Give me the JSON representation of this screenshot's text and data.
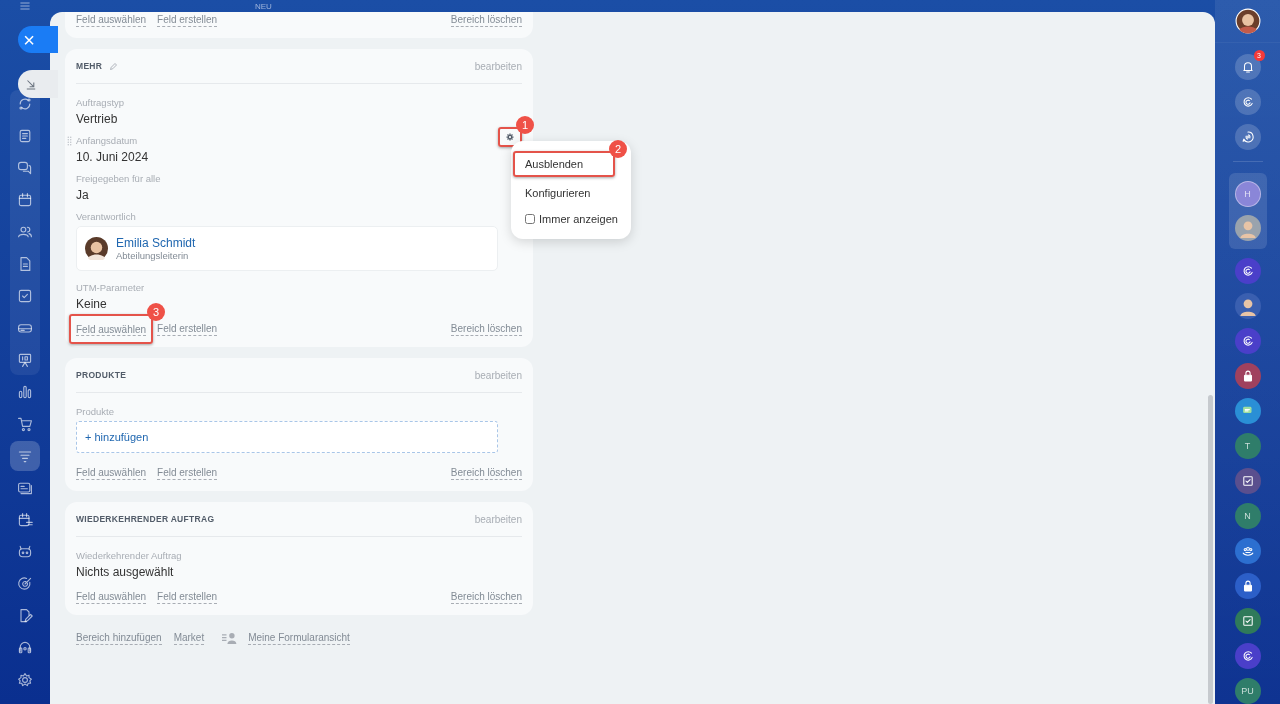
{
  "top_bar": {
    "badge": "NEU"
  },
  "left_nav": {
    "close_label": "×",
    "items": [
      {
        "kind": "sync",
        "selected": false
      },
      {
        "kind": "news",
        "selected": false
      },
      {
        "kind": "chat",
        "selected": false
      },
      {
        "kind": "calendar",
        "selected": false
      },
      {
        "kind": "contacts",
        "selected": false
      },
      {
        "kind": "document",
        "selected": false
      },
      {
        "kind": "task",
        "selected": false
      },
      {
        "kind": "drive",
        "selected": false
      },
      {
        "kind": "board",
        "selected": false
      },
      {
        "kind": "chart",
        "selected": false
      },
      {
        "kind": "cart",
        "selected": false
      },
      {
        "kind": "filter",
        "selected": true
      },
      {
        "kind": "cards",
        "selected": false
      },
      {
        "kind": "schedule",
        "selected": false
      },
      {
        "kind": "robot",
        "selected": false
      },
      {
        "kind": "target",
        "selected": false
      },
      {
        "kind": "edit",
        "selected": false
      },
      {
        "kind": "headset",
        "selected": false
      },
      {
        "kind": "flower",
        "selected": false
      }
    ]
  },
  "previous_section": {
    "links": [
      "Feld auswählen",
      "Feld erstellen"
    ],
    "delete": "Bereich löschen"
  },
  "sections": [
    {
      "title": "MEHR",
      "editable_title": true,
      "edit": "bearbeiten",
      "fields": [
        {
          "kind": "text",
          "label": "Auftragstyp",
          "value": "Vertrieb"
        },
        {
          "kind": "text",
          "label": "Anfangsdatum",
          "value": "10. Juni 2024",
          "hovered": true,
          "callout": "1"
        },
        {
          "kind": "text",
          "label": "Freigegeben für alle",
          "value": "Ja"
        },
        {
          "kind": "person",
          "label": "Verantwortlich",
          "name": "Emilia Schmidt",
          "role": "Abteilungsleiterin"
        },
        {
          "kind": "text",
          "label": "UTM-Parameter",
          "value": "Keine"
        }
      ],
      "links": [
        {
          "label": "Feld auswählen",
          "callout": "3"
        },
        {
          "label": "Feld erstellen"
        }
      ],
      "delete": "Bereich löschen"
    },
    {
      "title": "PRODUKTE",
      "editable_title": false,
      "edit": "bearbeiten",
      "fields": [
        {
          "kind": "add",
          "label": "Produkte",
          "value": "+ hinzufügen"
        }
      ],
      "links": [
        {
          "label": "Feld auswählen"
        },
        {
          "label": "Feld erstellen"
        }
      ],
      "delete": "Bereich löschen"
    },
    {
      "title": "WIEDERKEHRENDER AUFTRAG",
      "editable_title": false,
      "edit": "bearbeiten",
      "fields": [
        {
          "kind": "text",
          "label": "Wiederkehrender Auftrag",
          "value": "Nichts ausgewählt"
        }
      ],
      "links": [
        {
          "label": "Feld auswählen"
        },
        {
          "label": "Feld erstellen"
        }
      ],
      "delete": "Bereich löschen"
    }
  ],
  "bottom_links": [
    "Bereich hinzufügen",
    "Market"
  ],
  "form_view": "Meine Formularansicht",
  "field_menu": {
    "items": [
      {
        "kind": "action",
        "label": "Ausblenden",
        "callout": "2"
      },
      {
        "kind": "action",
        "label": "Konfigurieren"
      },
      {
        "kind": "checkbox",
        "label": "Immer anzeigen",
        "checked": false
      }
    ]
  },
  "right_bar": {
    "notifications": "3",
    "items": [
      {
        "kind": "copilot",
        "color": "#4a3fc9"
      },
      {
        "kind": "avatar",
        "color": "#3a5fb0"
      },
      {
        "kind": "copilot",
        "color": "#4a3fc9"
      },
      {
        "kind": "lock",
        "color": "#a0415e"
      },
      {
        "kind": "chat",
        "color": "#2a8fd6"
      },
      {
        "kind": "letter",
        "label": "T",
        "color": "#2f7d6a"
      },
      {
        "kind": "check",
        "color": "#5a4f8e"
      },
      {
        "kind": "letter",
        "label": "N",
        "color": "#2f7d6a"
      },
      {
        "kind": "people",
        "color": "#2c6fd0"
      },
      {
        "kind": "lock",
        "color": "#2c5fc8"
      },
      {
        "kind": "check",
        "color": "#2f7a5a"
      },
      {
        "kind": "copilot",
        "color": "#4a3fc9"
      },
      {
        "kind": "letter",
        "label": "PU",
        "color": "#2f7d6a"
      }
    ],
    "group": [
      {
        "kind": "letter",
        "label": "H"
      },
      {
        "kind": "avatar"
      }
    ]
  }
}
